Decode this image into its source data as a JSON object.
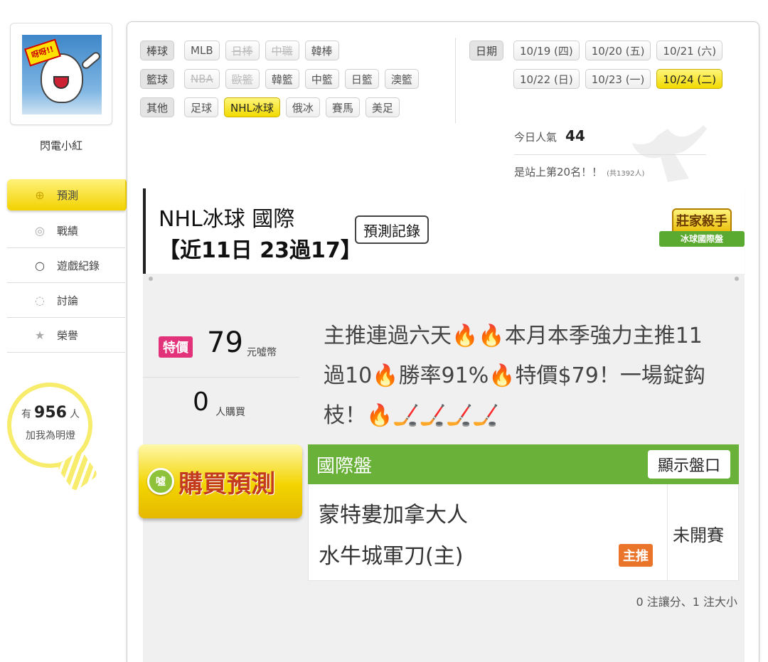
{
  "user": {
    "name": "閃電小紅",
    "avatar_shout": "呀呀!!"
  },
  "nav": [
    {
      "label": "預測",
      "icon": "target-icon",
      "active": true
    },
    {
      "label": "戰績",
      "icon": "spiral-icon",
      "active": false
    },
    {
      "label": "遊戲紀錄",
      "icon": "circle-icon",
      "active": false
    },
    {
      "label": "討論",
      "icon": "chat-icon",
      "active": false
    },
    {
      "label": "榮譽",
      "icon": "medal-icon",
      "active": false
    }
  ],
  "fans": {
    "prefix": "有",
    "count": "956",
    "suffix": "人",
    "line2": "加我為明燈"
  },
  "filters": {
    "baseball": {
      "category": "棒球",
      "items": [
        "MLB",
        "日棒",
        "中職",
        "韓棒"
      ]
    },
    "basketball": {
      "category": "籃球",
      "items": [
        "NBA",
        "歐籃",
        "韓籃",
        "中籃",
        "日籃",
        "澳籃"
      ]
    },
    "other": {
      "category": "其他",
      "items": [
        "足球",
        "NHL冰球",
        "俄冰",
        "賽馬",
        "美足"
      ]
    }
  },
  "dates": {
    "label": "日期",
    "items": [
      "10/19 (四)",
      "10/20 (五)",
      "10/21 (六)",
      "10/22 (日)",
      "10/23 (一)",
      "10/24 (二)"
    ]
  },
  "stats": {
    "popular_label": "今日人氣",
    "popular_value": "44",
    "rank_text": "是站上第20名！！",
    "rank_total": "(共1392人)"
  },
  "prediction": {
    "title": "NHL冰球 國際",
    "subtitle": "【近11日 23過17】",
    "record_button": "預測記錄",
    "badge_top": "莊家殺手",
    "badge_ribbon": "冰球國際盤",
    "special_label": "特價",
    "price": "79",
    "price_unit": "元噓幣",
    "buyers": "0",
    "buyers_unit": "人購買",
    "description": "主推連過六天🔥🔥本月本季強力主推11過10🔥勝率91%🔥特價$79！一場錠鈎枝！🔥🏒🏒🏒🏒",
    "buy_button": "購買預測",
    "buy_coin": "噓",
    "market_name": "國際盤",
    "show_odds_button": "顯示盤口",
    "team_away": "蒙特婁加拿大人",
    "team_home": "水牛城軍刀(主)",
    "main_pick_tag": "主推",
    "status": "未開賽",
    "counts_text": "0 注讓分、1 注大小"
  },
  "colors": {
    "accent_yellow": "#f2d200",
    "market_green": "#6ab13a",
    "special_pink": "#e2327a",
    "main_pick_orange": "#e9742a"
  }
}
